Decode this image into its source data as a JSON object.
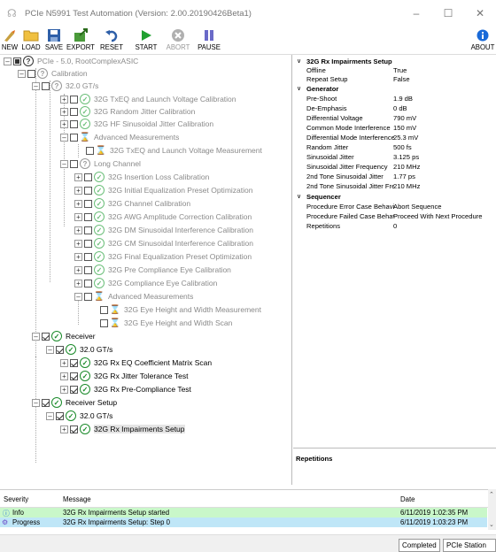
{
  "window": {
    "title": "PCIe N5991 Test Automation (Version: 2.00.20190426Beta1)",
    "app_icon": "app-icon",
    "controls": [
      "minimize-icon",
      "maximize-icon",
      "close-icon"
    ]
  },
  "toolbar": {
    "new_label": "NEW",
    "load_label": "LOAD",
    "save_label": "SAVE",
    "export_label": "EXPORT",
    "reset_label": "RESET",
    "start_label": "START",
    "abort_label": "ABORT",
    "pause_label": "PAUSE",
    "about_label": "ABOUT"
  },
  "tree": {
    "root": "PCIe - 5.0, RootComplexASIC",
    "calibration": "Calibration",
    "rate1": "32.0 GT/s",
    "txeq": "32G TxEQ and Launch Voltage Calibration",
    "rj": "32G Random Jitter Calibration",
    "hfsj": "32G HF Sinusoidal Jitter Calibration",
    "adv1": "Advanced Measurements",
    "txeq_meas": "32G TxEQ and Launch Voltage Measurement",
    "long_channel": "Long Channel",
    "il": "32G Insertion Loss Calibration",
    "init_eq": "32G Initial Equalization Preset Optimization",
    "chan": "32G Channel Calibration",
    "awg": "32G AWG Amplitude Correction Calibration",
    "dmsi": "32G DM Sinusoidal Interference Calibration",
    "cmsi": "32G CM Sinusoidal Interference Calibration",
    "final_eq": "32G Final Equalization Preset Optimization",
    "pre_eye": "32G Pre Compliance Eye Calibration",
    "comp_eye": "32G Compliance Eye Calibration",
    "adv2": "Advanced Measurements",
    "eye_meas": "32G Eye Height and Width Measurement",
    "eye_scan": "32G Eye Height and Width Scan",
    "receiver": "Receiver",
    "rate2": "32.0 GT/s",
    "rx_eq": "32G Rx EQ Coefficient Matrix Scan",
    "rx_jt": "32G Rx Jitter Tolerance Test",
    "rx_pc": "32G Rx Pre-Compliance Test",
    "receiver_setup": "Receiver Setup",
    "rate3": "32.0 GT/s",
    "rx_imp": "32G Rx Impairments Setup"
  },
  "properties": {
    "cat1": "32G Rx Impairments Setup",
    "offline_k": "Offline",
    "offline_v": "True",
    "repeat_k": "Repeat Setup",
    "repeat_v": "False",
    "cat2": "Generator",
    "preshoot_k": "Pre-Shoot",
    "preshoot_v": "1.9 dB",
    "deemph_k": "De-Emphasis",
    "deemph_v": "0 dB",
    "diffv_k": "Differential Voltage",
    "diffv_v": "790 mV",
    "cmi_k": "Common Mode Interference",
    "cmi_v": "150 mV",
    "dmi_k": "Differential Mode Interference",
    "dmi_v": "25.3 mV",
    "rj_k": "Random Jitter",
    "rj_v": "500 fs",
    "sj_k": "Sinusoidal Jitter",
    "sj_v": "3.125 ps",
    "sjf_k": "Sinusoidal Jitter Frequency",
    "sjf_v": "210 MHz",
    "sj2_k": "2nd Tone Sinusoidal Jitter",
    "sj2_v": "1.77 ps",
    "sj2f_k": "2nd Tone Sinusoidal Jitter Frequency",
    "sj2f_v": "210 MHz",
    "cat3": "Sequencer",
    "pe_k": "Procedure Error Case Behavior",
    "pe_v": "Abort Sequence",
    "pf_k": "Procedure Failed Case Behavior",
    "pf_v": "Proceed With Next Procedure",
    "rep_k": "Repetitions",
    "rep_v": "0"
  },
  "description": {
    "title": "Repetitions"
  },
  "log": {
    "col_severity": "Severity",
    "col_message": "Message",
    "col_date": "Date",
    "rows": [
      {
        "severity": "Info",
        "message": "32G Rx Impairments Setup started",
        "date": "6/11/2019 1:02:35 PM"
      },
      {
        "severity": "Progress",
        "message": "32G Rx Impairments Setup: Step 0",
        "date": "6/11/2019 1:03:23 PM"
      }
    ]
  },
  "status": {
    "state": "Completed",
    "station": "PCIe Station"
  },
  "colors": {
    "pass_green": "#1a8a2a",
    "log_info_bg": "#c9f7c9",
    "log_progress_bg": "#bfe6f7"
  }
}
